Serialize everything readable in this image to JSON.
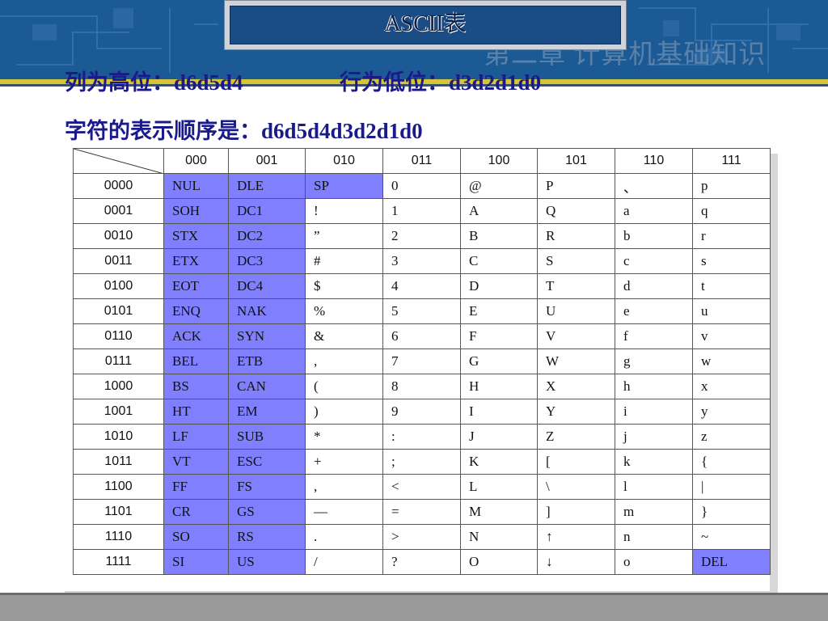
{
  "header": {
    "title": "ASCII表",
    "chapter_watermark": "第二章  计算机基础知识"
  },
  "intro": {
    "line1_left": "列为高位：d6d5d4",
    "line1_right": "行为低位：d3d2d1d0",
    "line2": "字符的表示顺序是：d6d5d4d3d2d1d0"
  },
  "table": {
    "columns": [
      "000",
      "001",
      "010",
      "011",
      "100",
      "101",
      "110",
      "111"
    ],
    "rows": [
      {
        "label": "0000",
        "cells": [
          "NUL",
          "DLE",
          "SP",
          "0",
          "@",
          "P",
          "、",
          "p"
        ]
      },
      {
        "label": "0001",
        "cells": [
          "SOH",
          "DC1",
          "!",
          "1",
          "A",
          "Q",
          "a",
          "q"
        ]
      },
      {
        "label": "0010",
        "cells": [
          "STX",
          "DC2",
          "”",
          "2",
          "B",
          "R",
          "b",
          "r"
        ]
      },
      {
        "label": "0011",
        "cells": [
          "ETX",
          "DC3",
          "#",
          "3",
          "C",
          "S",
          "c",
          "s"
        ]
      },
      {
        "label": "0100",
        "cells": [
          "EOT",
          "DC4",
          "$",
          "4",
          "D",
          "T",
          "d",
          "t"
        ]
      },
      {
        "label": "0101",
        "cells": [
          "ENQ",
          "NAK",
          "%",
          "5",
          "E",
          "U",
          "e",
          "u"
        ]
      },
      {
        "label": "0110",
        "cells": [
          "ACK",
          "SYN",
          "&",
          "6",
          "F",
          "V",
          "f",
          "v"
        ]
      },
      {
        "label": "0111",
        "cells": [
          "BEL",
          "ETB",
          ",",
          "7",
          "G",
          "W",
          "g",
          "w"
        ]
      },
      {
        "label": "1000",
        "cells": [
          "BS",
          "CAN",
          "(",
          "8",
          "H",
          "X",
          "h",
          "x"
        ]
      },
      {
        "label": "1001",
        "cells": [
          "HT",
          "EM",
          ")",
          "9",
          "I",
          "Y",
          "i",
          "y"
        ]
      },
      {
        "label": "1010",
        "cells": [
          "LF",
          "SUB",
          "*",
          ":",
          "J",
          "Z",
          "j",
          "z"
        ]
      },
      {
        "label": "1011",
        "cells": [
          "VT",
          "ESC",
          "+",
          ";",
          "K",
          "[",
          "k",
          "{"
        ]
      },
      {
        "label": "1100",
        "cells": [
          "FF",
          "FS",
          ",",
          "<",
          "L",
          "\\",
          "l",
          "|"
        ]
      },
      {
        "label": "1101",
        "cells": [
          "CR",
          "GS",
          "—",
          "=",
          "M",
          "]",
          "m",
          "}"
        ]
      },
      {
        "label": "1110",
        "cells": [
          "SO",
          "RS",
          ".",
          ">",
          "N",
          "↑",
          "n",
          "~"
        ]
      },
      {
        "label": "1111",
        "cells": [
          "SI",
          "US",
          "/",
          "?",
          "O",
          "↓",
          "o",
          "DEL"
        ]
      }
    ]
  },
  "colors": {
    "control_highlight": "#8080ff",
    "banner": "#1b5a95",
    "accent_stripe": "#d6c43a",
    "intro_text": "#1a1a8a"
  }
}
